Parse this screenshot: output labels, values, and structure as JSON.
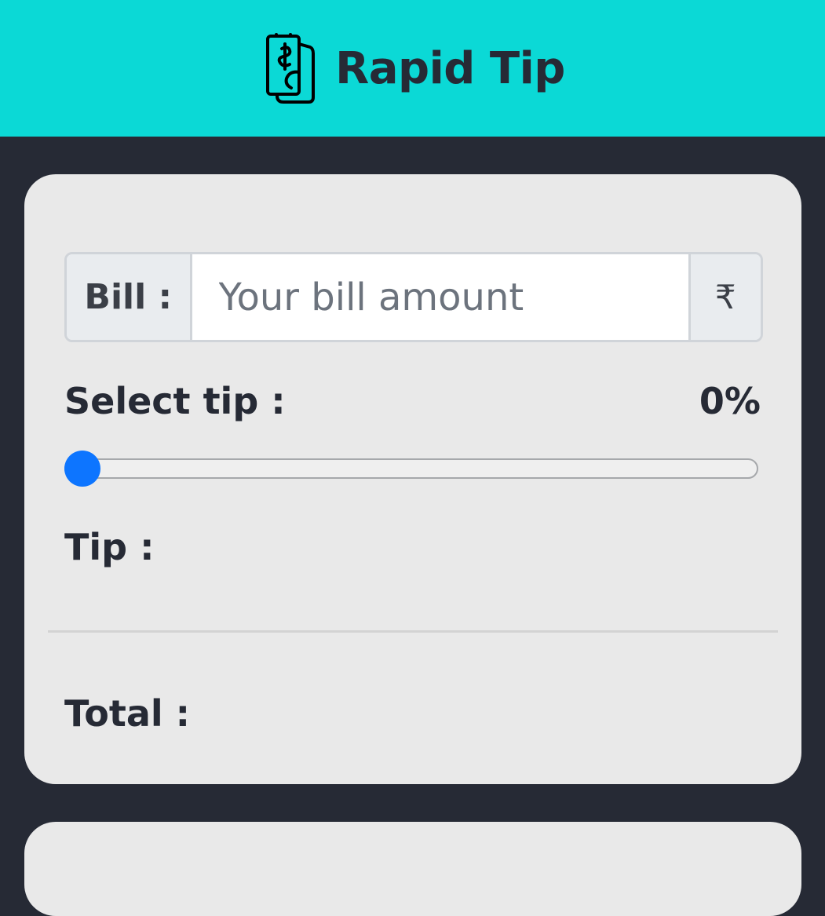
{
  "header": {
    "title": "Rapid Tip",
    "logo_icon": "money-hand-icon",
    "background": "#0bd9d6"
  },
  "calculator": {
    "bill_label": "Bill :",
    "bill_input_value": "",
    "bill_placeholder": "Your bill amount",
    "currency_symbol": "₹",
    "select_tip_label": "Select tip :",
    "tip_percent_text": "0%",
    "tip_percent_value": 0,
    "tip_label": "Tip :",
    "tip_value": "",
    "total_label": "Total :",
    "total_value": "",
    "slider_color": "#0d75ff"
  }
}
